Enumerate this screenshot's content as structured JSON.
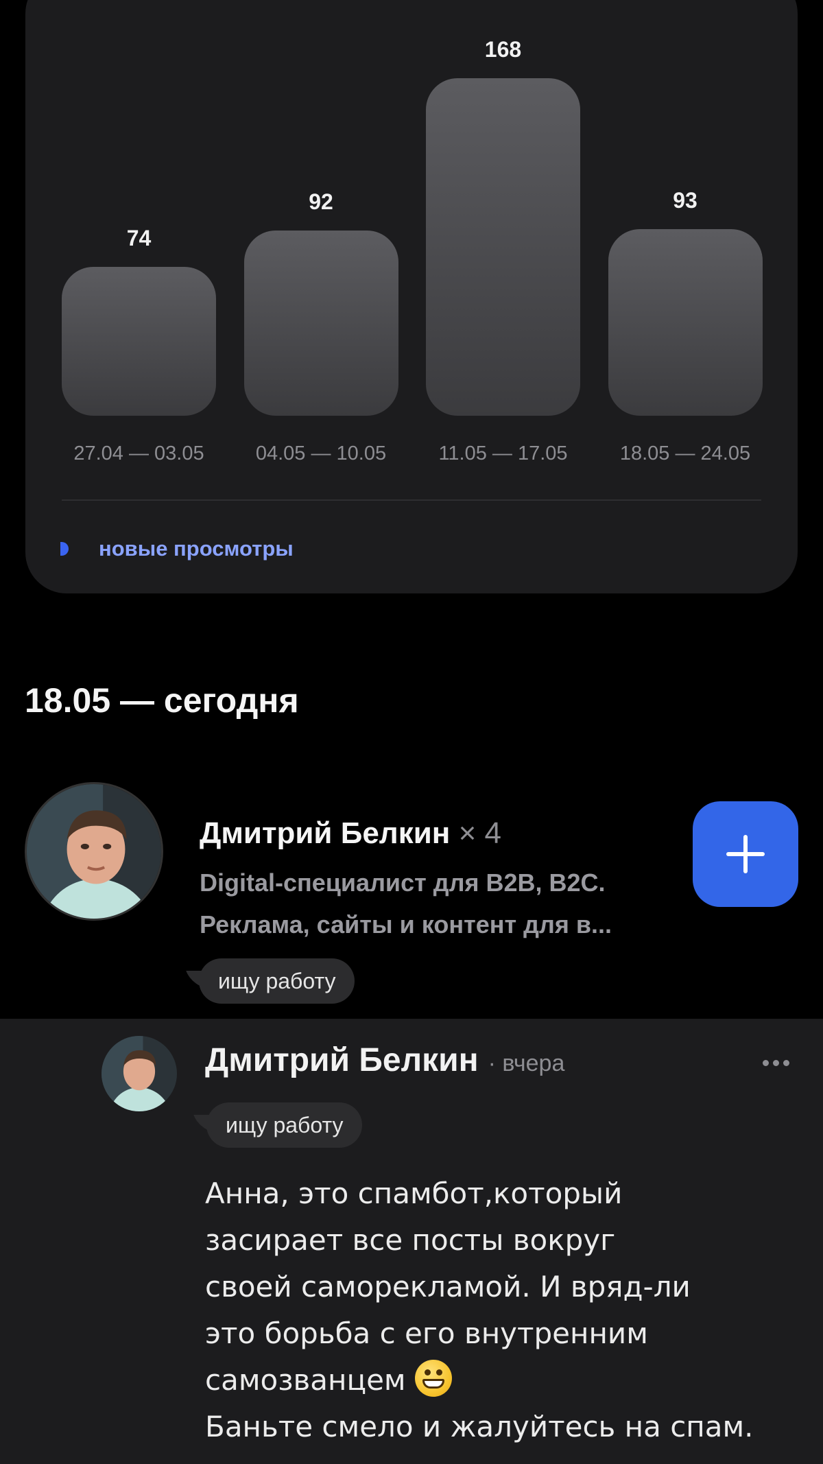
{
  "chart_data": {
    "type": "bar",
    "categories": [
      "27.04 — 03.05",
      "04.05 — 10.05",
      "11.05 — 17.05",
      "18.05 — 24.05"
    ],
    "series": [
      {
        "name": "новые просмотры",
        "values": [
          74,
          92,
          168,
          93
        ]
      }
    ],
    "value_labels": [
      "74",
      "92",
      "168",
      "93"
    ],
    "legend": "bottom-left",
    "colors": {
      "bar_top": "#5c5c60",
      "bar_bottom": "#3b3b3e",
      "legend_marker": "#3a64f1",
      "legend_text": "#8aa3ff"
    }
  },
  "legend_label": "новые просмотры",
  "section": {
    "title": "18.05 — сегодня"
  },
  "profile": {
    "name": "Дмитрий Белкин",
    "count": "× 4",
    "description": "Digital-специалист для B2B, B2C. Реклама, сайты и контент для в...",
    "status": "ищу работу",
    "follow_icon": "plus-icon",
    "accent_color": "#3366e8"
  },
  "comment": {
    "author": "Дмитрий Белкин",
    "time": "· вчера",
    "status": "ищу работу",
    "text_part1": "Анна, это спамбот,который\nзасирает все посты вокруг\nсвоей саморекламой. И вряд-ли\nэто борьба с его внутренним\nсамозванцем ",
    "emoji": "grinning-face-emoji",
    "text_part2": "\nБаньте смело и жалуйтесь на спам.",
    "menu_icon": "more-horizontal-icon"
  }
}
